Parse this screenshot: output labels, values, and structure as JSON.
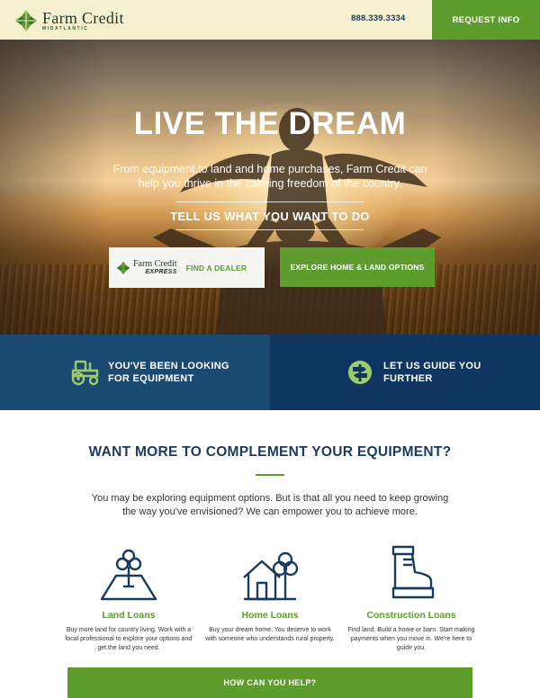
{
  "header": {
    "brand_name": "Farm Credit",
    "brand_sub": "MIDATLANTIC",
    "phone": "888.339.3334",
    "request_label": "REQUEST INFO"
  },
  "hero": {
    "title": "LIVE THE DREAM",
    "subtitle": "From equipment to land and home purchases, Farm Credit can help you thrive in the calming freedom of the country.",
    "tell_label": "TELL US WHAT YOU WANT TO DO",
    "dealer_brand": "Farm Credit",
    "dealer_brand_sub": "EXPRESS",
    "dealer_label": "FIND A DEALER",
    "explore_label": "EXPLORE HOME & LAND OPTIONS"
  },
  "bands": {
    "equipment": {
      "label": "YOU'VE BEEN LOOKING FOR EQUIPMENT",
      "icon": "tractor-icon"
    },
    "guide": {
      "label": "LET US GUIDE YOU FURTHER",
      "icon": "signpost-icon"
    }
  },
  "section": {
    "title": "WANT MORE TO COMPLEMENT YOUR EQUIPMENT?",
    "description": "You may be exploring equipment options. But is that all you need to keep growing the way you've envisioned? We can empower you to achieve more."
  },
  "cards": [
    {
      "title": "Land Loans",
      "description": "Buy more land for country living. Work with a local professional to explore your options and get the land you need.",
      "icon": "land-tree-icon"
    },
    {
      "title": "Home Loans",
      "description": "Buy your dream home. You deserve to work with someone who understands rural property.",
      "icon": "house-icon"
    },
    {
      "title": "Construction Loans",
      "description": "Find land. Build a home or barn. Start making payments when you move in. We're here to guide you.",
      "icon": "boot-icon"
    }
  ],
  "cta": {
    "label": "HOW CAN YOU HELP?"
  },
  "colors": {
    "green": "#5e9d2d",
    "navy": "#1b3a5c",
    "band_left": "#1b4a70",
    "band_right": "#0f3560",
    "header_bg": "#f3efcf"
  }
}
